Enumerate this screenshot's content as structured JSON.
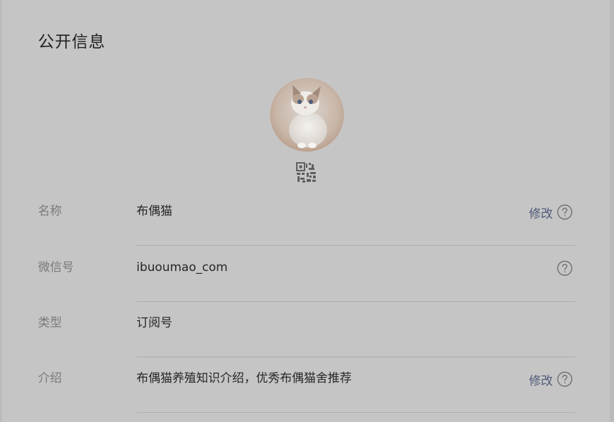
{
  "section": {
    "title": "公开信息"
  },
  "rows": [
    {
      "label": "名称",
      "value": "布偶猫",
      "edit": "修改"
    },
    {
      "label": "微信号",
      "value": "ibuoumao_com"
    },
    {
      "label": "类型",
      "value": "订阅号"
    },
    {
      "label": "介绍",
      "value": "布偶猫养殖知识介绍，优秀布偶猫舍推荐",
      "edit": "修改"
    }
  ],
  "icons": {
    "avatar": "cat-avatar-image",
    "qr": "qr-code-icon",
    "help": "help-circle-icon"
  },
  "colors": {
    "background": "#c6c5c6",
    "link": "#4f5a78",
    "label": "#7a7a7a",
    "text": "#262626"
  }
}
